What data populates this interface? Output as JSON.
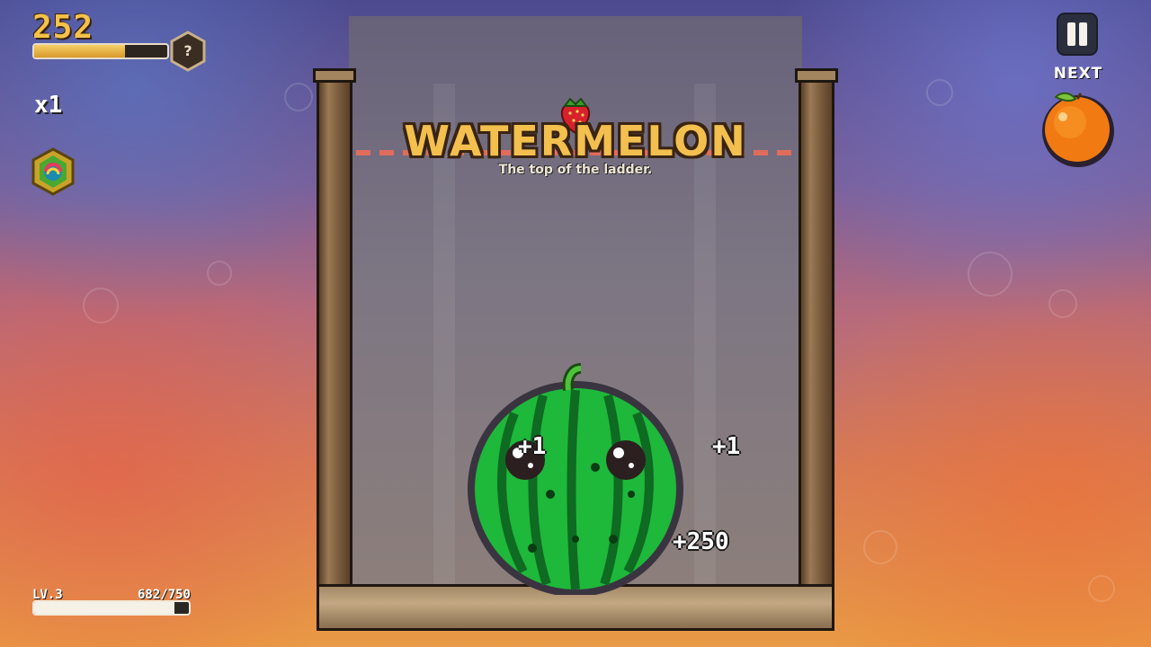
{
  "hud": {
    "score": "252",
    "score_progress": 0.68,
    "mystery_badge": "?",
    "multiplier": "x1",
    "pause_icon": "pause-icon",
    "next_label": "NEXT",
    "next_fruit": "orange",
    "level_label": "LV.3",
    "xp_text": "682/750",
    "xp_progress": 0.909,
    "powerup_icon": "rainbow-gem-icon"
  },
  "banner": {
    "title": "WATERMELON",
    "subtitle": "The top of the ladder.",
    "icon": "strawberry-icon"
  },
  "board": {
    "fruit": "watermelon",
    "popups": [
      "+1",
      "+1",
      "+250"
    ]
  },
  "colors": {
    "score_gold": "#f5c24a",
    "danger_line": "#e06c5c",
    "melon_green": "#1eb83a"
  }
}
